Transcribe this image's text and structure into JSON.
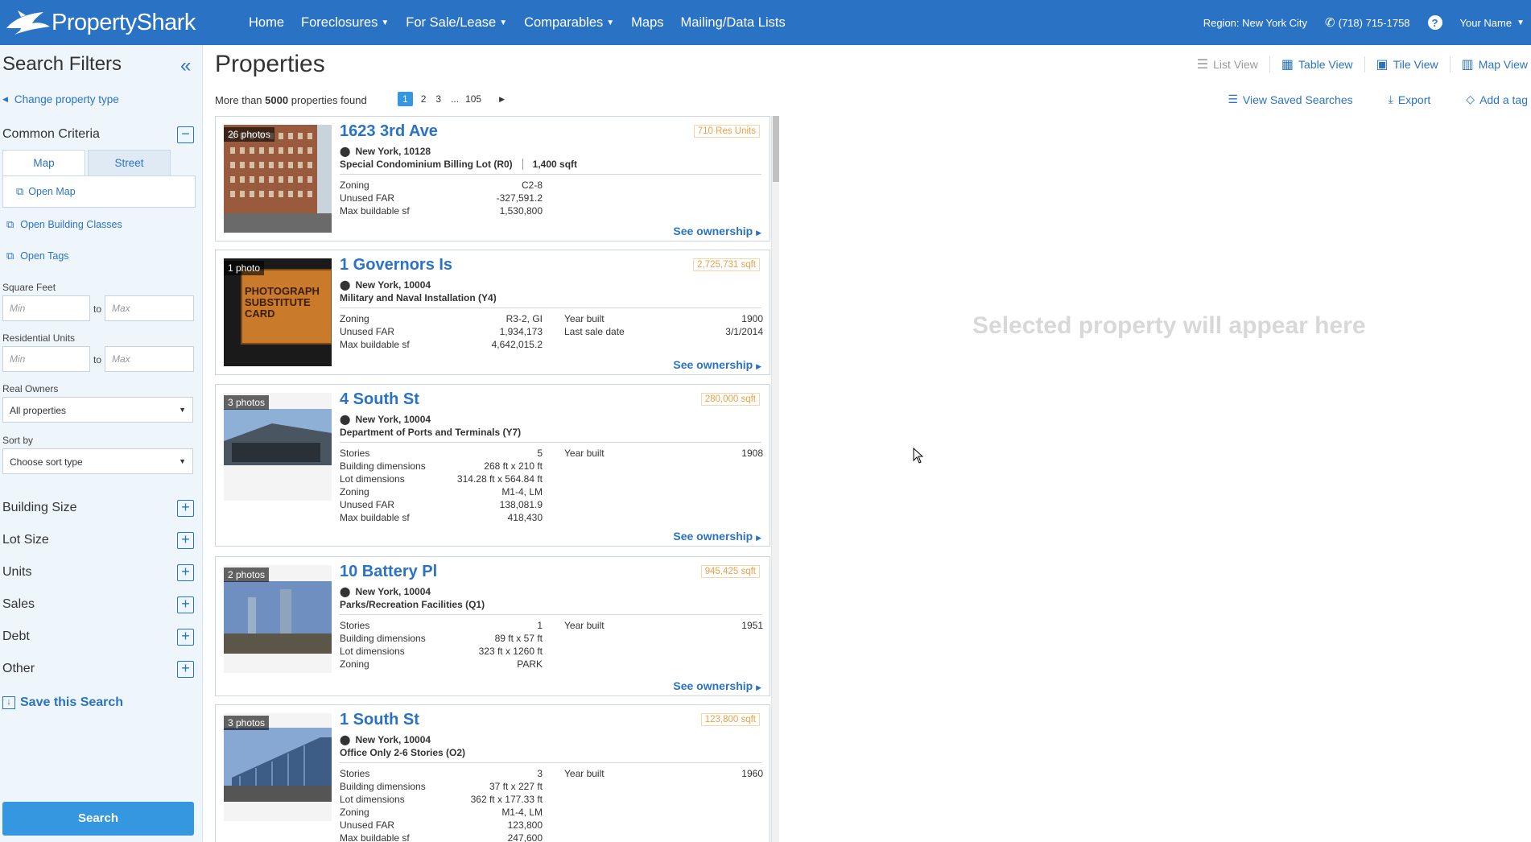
{
  "header": {
    "brand": "PropertyShark",
    "nav": [
      {
        "label": "Home",
        "dropdown": false
      },
      {
        "label": "Foreclosures",
        "dropdown": true
      },
      {
        "label": "For Sale/Lease",
        "dropdown": true
      },
      {
        "label": "Comparables",
        "dropdown": true
      },
      {
        "label": "Maps",
        "dropdown": false
      },
      {
        "label": "Mailing/Data Lists",
        "dropdown": false
      }
    ],
    "region": "Region: New York City",
    "phone": "(718) 715-1758",
    "user": "Your Name",
    "colors": {
      "bar": "#2a73c4"
    }
  },
  "sidebar": {
    "title": "Search Filters",
    "change_type": "Change property type",
    "common_criteria": "Common Criteria",
    "tabs": [
      "Map",
      "Street"
    ],
    "open_map": "Open Map",
    "open_building_classes": "Open Building Classes",
    "open_tags": "Open Tags",
    "square_feet_label": "Square Feet",
    "residential_units_label": "Residential Units",
    "min_placeholder": "Min",
    "max_placeholder": "Max",
    "to": "to",
    "real_owners_label": "Real Owners",
    "real_owners_value": "All properties",
    "sort_label": "Sort by",
    "sort_value": "Choose sort type",
    "sections": [
      "Building Size",
      "Lot Size",
      "Units",
      "Sales",
      "Debt",
      "Other"
    ],
    "save_search": "Save this Search",
    "search_button": "Search"
  },
  "main": {
    "title": "Properties",
    "results_prefix": "More than",
    "results_count": "5000",
    "results_suffix": "properties found",
    "pages": [
      "1",
      "2",
      "3",
      "...",
      "105"
    ],
    "current_page": "1",
    "views": [
      "List View",
      "Table View",
      "Tile View",
      "Map View"
    ],
    "actions": [
      "View Saved Searches",
      "Export",
      "Add a tag"
    ],
    "see_ownership": "See ownership",
    "placeholder": "Selected property will appear here"
  },
  "properties": [
    {
      "photos": "26 photos",
      "address": "1623 3rd Ave",
      "tag": "710 Res Units",
      "city": "New York, 10128",
      "class": "Special Condominium Billing Lot (R0)",
      "extra": "1,400 sqft",
      "left": [
        [
          "Zoning",
          "C2-8"
        ],
        [
          "Unused FAR",
          "-327,591.2"
        ],
        [
          "Max buildable sf",
          "1,530,800"
        ]
      ],
      "right": []
    },
    {
      "photos": "1 photo",
      "address": "1 Governors Is",
      "tag": "2,725,731 sqft",
      "city": "New York, 10004",
      "class": "Military and Naval Installation (Y4)",
      "extra": "",
      "left": [
        [
          "Zoning",
          "R3-2, GI"
        ],
        [
          "Unused FAR",
          "1,934,173"
        ],
        [
          "Max buildable sf",
          "4,642,015.2"
        ]
      ],
      "right": [
        [
          "Year built",
          "1900"
        ],
        [
          "Last sale date",
          "3/1/2014"
        ]
      ],
      "photo_text": "PHOTOGRAPH SUBSTITUTE CARD"
    },
    {
      "photos": "3 photos",
      "address": "4 South St",
      "tag": "280,000 sqft",
      "city": "New York, 10004",
      "class": "Department of Ports and Terminals (Y7)",
      "extra": "",
      "left": [
        [
          "Stories",
          "5"
        ],
        [
          "Building dimensions",
          "268 ft x 210 ft"
        ],
        [
          "Lot dimensions",
          "314.28 ft x 564.84 ft"
        ],
        [
          "Zoning",
          "M1-4, LM"
        ],
        [
          "Unused FAR",
          "138,081.9"
        ],
        [
          "Max buildable sf",
          "418,430"
        ]
      ],
      "right": [
        [
          "Year built",
          "1908"
        ]
      ]
    },
    {
      "photos": "2 photos",
      "address": "10 Battery Pl",
      "tag": "945,425 sqft",
      "city": "New York, 10004",
      "class": "Parks/Recreation Facilities (Q1)",
      "extra": "",
      "left": [
        [
          "Stories",
          "1"
        ],
        [
          "Building dimensions",
          "89 ft x 57 ft"
        ],
        [
          "Lot dimensions",
          "323 ft x 1260 ft"
        ],
        [
          "Zoning",
          "PARK"
        ]
      ],
      "right": [
        [
          "Year built",
          "1951"
        ]
      ]
    },
    {
      "photos": "3 photos",
      "address": "1 South St",
      "tag": "123,800 sqft",
      "city": "New York, 10004",
      "class": "Office Only 2-6 Stories (O2)",
      "extra": "",
      "left": [
        [
          "Stories",
          "3"
        ],
        [
          "Building dimensions",
          "37 ft x 227 ft"
        ],
        [
          "Lot dimensions",
          "362 ft x 177.33 ft"
        ],
        [
          "Zoning",
          "M1-4, LM"
        ],
        [
          "Unused FAR",
          "123,800"
        ],
        [
          "Max buildable sf",
          "247,600"
        ]
      ],
      "right": [
        [
          "Year built",
          "1960"
        ]
      ]
    }
  ]
}
